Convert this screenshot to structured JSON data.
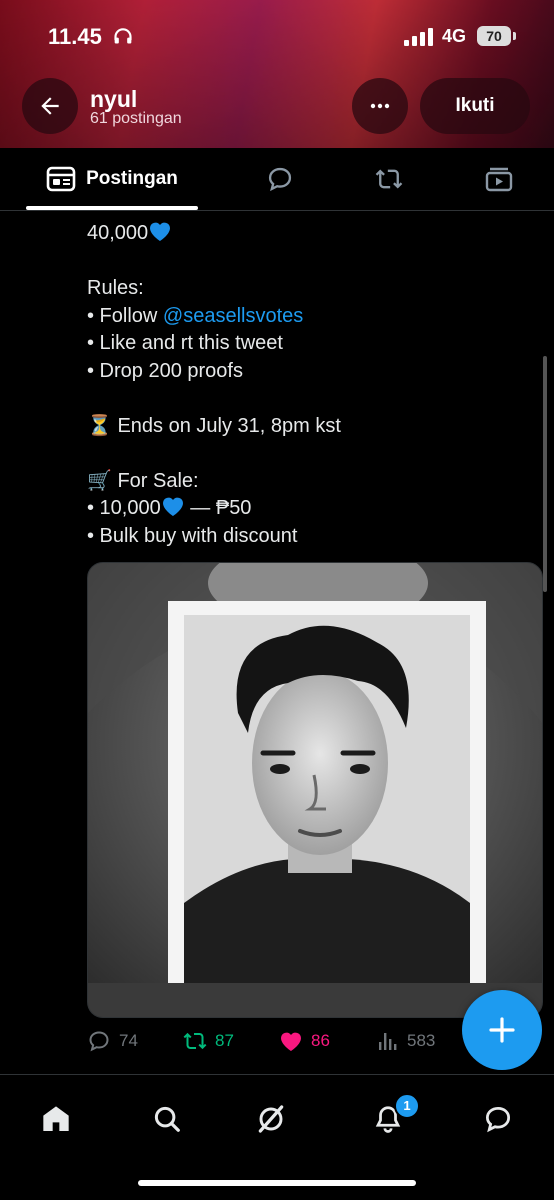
{
  "status_bar": {
    "time": "11.45",
    "network": "4G",
    "battery": "70"
  },
  "header": {
    "name": "nyul",
    "posts_count": "61 postingan",
    "follow_label": "Ikuti"
  },
  "tabs": {
    "active_label": "Postingan"
  },
  "post": {
    "lines": {
      "l1": "40,000",
      "rules": "Rules:",
      "follow_prefix": "• Follow ",
      "mention": "@seasellsvotes",
      "like": "• Like and rt this tweet",
      "drop": "• Drop 200 proofs",
      "ends": "Ends on July 31, 8pm kst",
      "for_sale": "For Sale:",
      "price_prefix": "• 10,000",
      "price_suffix": " — ₱50",
      "bulk": "• Bulk buy with discount"
    },
    "emojis": {
      "hourglass": "⏳",
      "cart": "🛒"
    },
    "stats": {
      "replies": "74",
      "reposts": "87",
      "likes": "86",
      "views": "583"
    }
  },
  "nav": {
    "notifications_badge": "1"
  },
  "colors": {
    "accent": "#1d9bf0",
    "repost": "#00ba7c",
    "like": "#f91880",
    "text": "#e7e9ea",
    "muted": "#71767b"
  },
  "icons": [
    "back-arrow-icon",
    "more-icon",
    "headphones-icon",
    "signal-icon",
    "feed-icon",
    "reply-icon",
    "repost-icon",
    "media-icon",
    "blue-heart-icon",
    "hourglass-icon",
    "cart-icon",
    "heart-icon",
    "views-icon",
    "plus-icon",
    "home-icon",
    "search-icon",
    "grok-icon",
    "bell-icon",
    "messages-icon"
  ]
}
